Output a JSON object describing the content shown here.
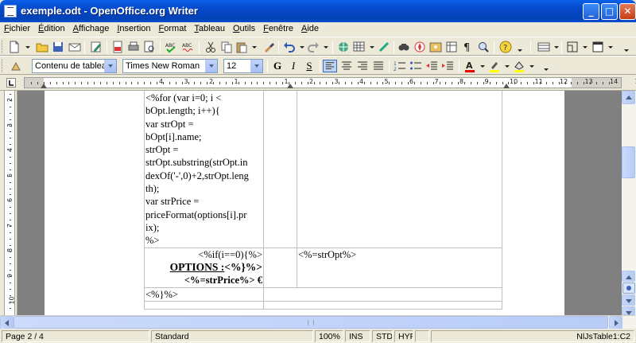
{
  "window": {
    "title": "exemple.odt - OpenOffice.org Writer"
  },
  "menu": [
    "Fichier",
    "Édition",
    "Affichage",
    "Insertion",
    "Format",
    "Tableau",
    "Outils",
    "Fenêtre",
    "Aide"
  ],
  "format_bar": {
    "style": "Contenu de tableau",
    "font": "Times New Roman",
    "size": "12",
    "bold": "G",
    "italic": "I",
    "underline": "S"
  },
  "ruler": {
    "h_labels": [
      "4",
      "3",
      "2",
      "1",
      "1",
      "2",
      "3",
      "4",
      "5",
      "6",
      "7",
      "8",
      "9",
      "10",
      "11",
      "12",
      "13",
      "14",
      "15",
      "16"
    ],
    "v_labels": [
      "2",
      "3",
      "4",
      "5",
      "6",
      "7",
      "8",
      "9",
      "10"
    ]
  },
  "document": {
    "rows": [
      {
        "c1": [
          "<%for (var i=0; i <",
          "bOpt.length; i++){",
          "var strOpt =",
          "bOpt[i].name;",
          "strOpt =",
          "strOpt.substring(strOpt.in",
          "dexOf('-',0)+2,strOpt.leng",
          "th);",
          "var strPrice =",
          "priceFormat(options[i].pr",
          "ix);",
          "%>"
        ],
        "c2": "",
        "c3": ""
      },
      {
        "c1_line1": "<%if(i==0){%>",
        "c1_label": "OPTIONS :",
        "c1_label_tail": "<%}%>",
        "c1_line3": "<%=strPrice%> €",
        "c2": "",
        "c3": "<%=strOpt%>"
      },
      {
        "c1": "<%}%>",
        "c2": "",
        "c3": ""
      }
    ]
  },
  "status": {
    "page": "Page 2 / 4",
    "style": "Standard",
    "zoom": "100%",
    "insert": "INS",
    "selection": "STD",
    "hyperlink": "HYP",
    "modified": "",
    "cell": "NlJsTable1:C2"
  },
  "colors": {
    "titlebar": "#0449C9",
    "page": "#FFFFFF",
    "canvas": "#808080"
  }
}
